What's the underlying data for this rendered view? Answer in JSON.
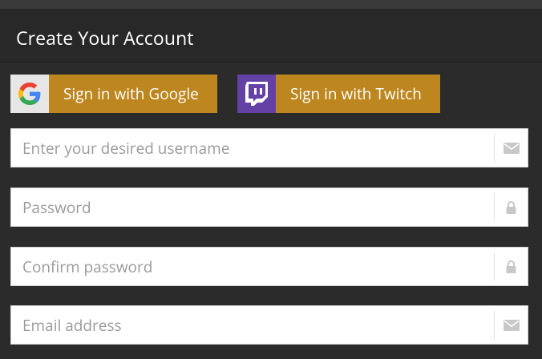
{
  "header": {
    "title": "Create Your Account"
  },
  "social": {
    "google": {
      "label": "Sign in with Google",
      "icon": "google-g-icon"
    },
    "twitch": {
      "label": "Sign in with Twitch",
      "icon": "twitch-icon"
    }
  },
  "fields": {
    "username": {
      "placeholder": "Enter your desired username",
      "value": "",
      "icon": "envelope-icon"
    },
    "password": {
      "placeholder": "Password",
      "value": "",
      "icon": "lock-icon"
    },
    "confirm": {
      "placeholder": "Confirm password",
      "value": "",
      "icon": "lock-icon"
    },
    "email": {
      "placeholder": "Email address",
      "value": "",
      "icon": "envelope-icon"
    }
  },
  "colors": {
    "background": "#2b2b2b",
    "accent": "#bd861e",
    "twitch": "#6441a4",
    "google_tile": "#e6e6e6"
  }
}
